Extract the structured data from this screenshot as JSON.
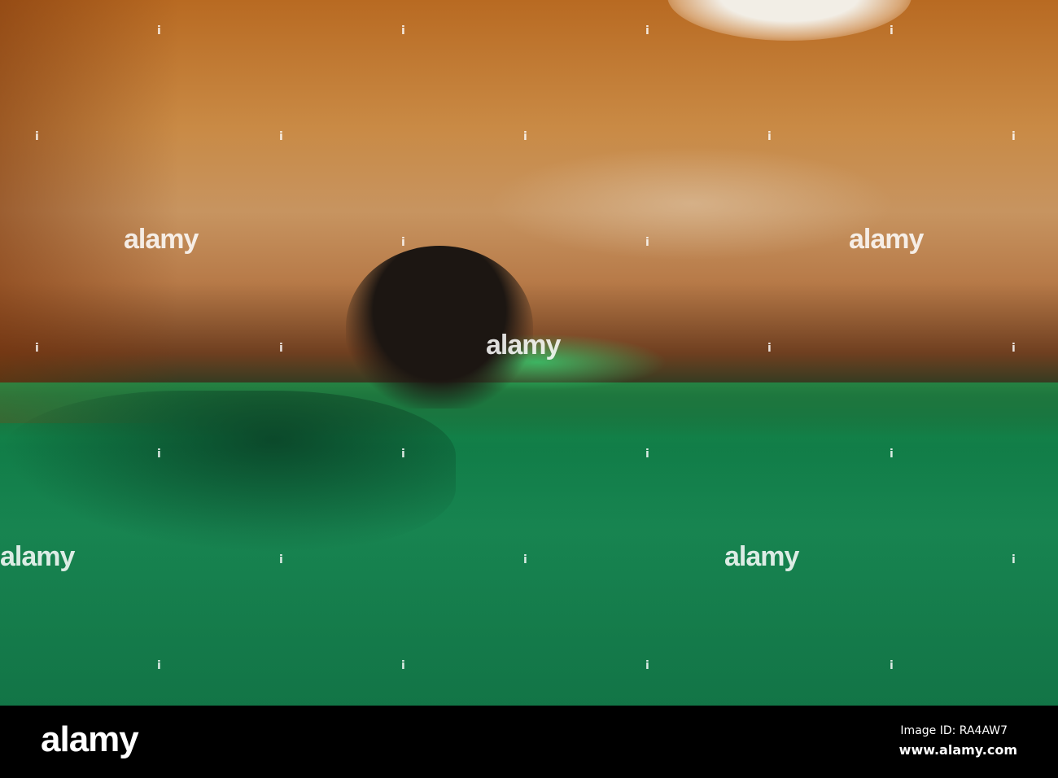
{
  "watermark": "alamy",
  "watermark_mark": "i",
  "footer": {
    "logo": "alamy",
    "image_id": "Image ID: RA4AW7",
    "website": "www.alamy.com"
  }
}
